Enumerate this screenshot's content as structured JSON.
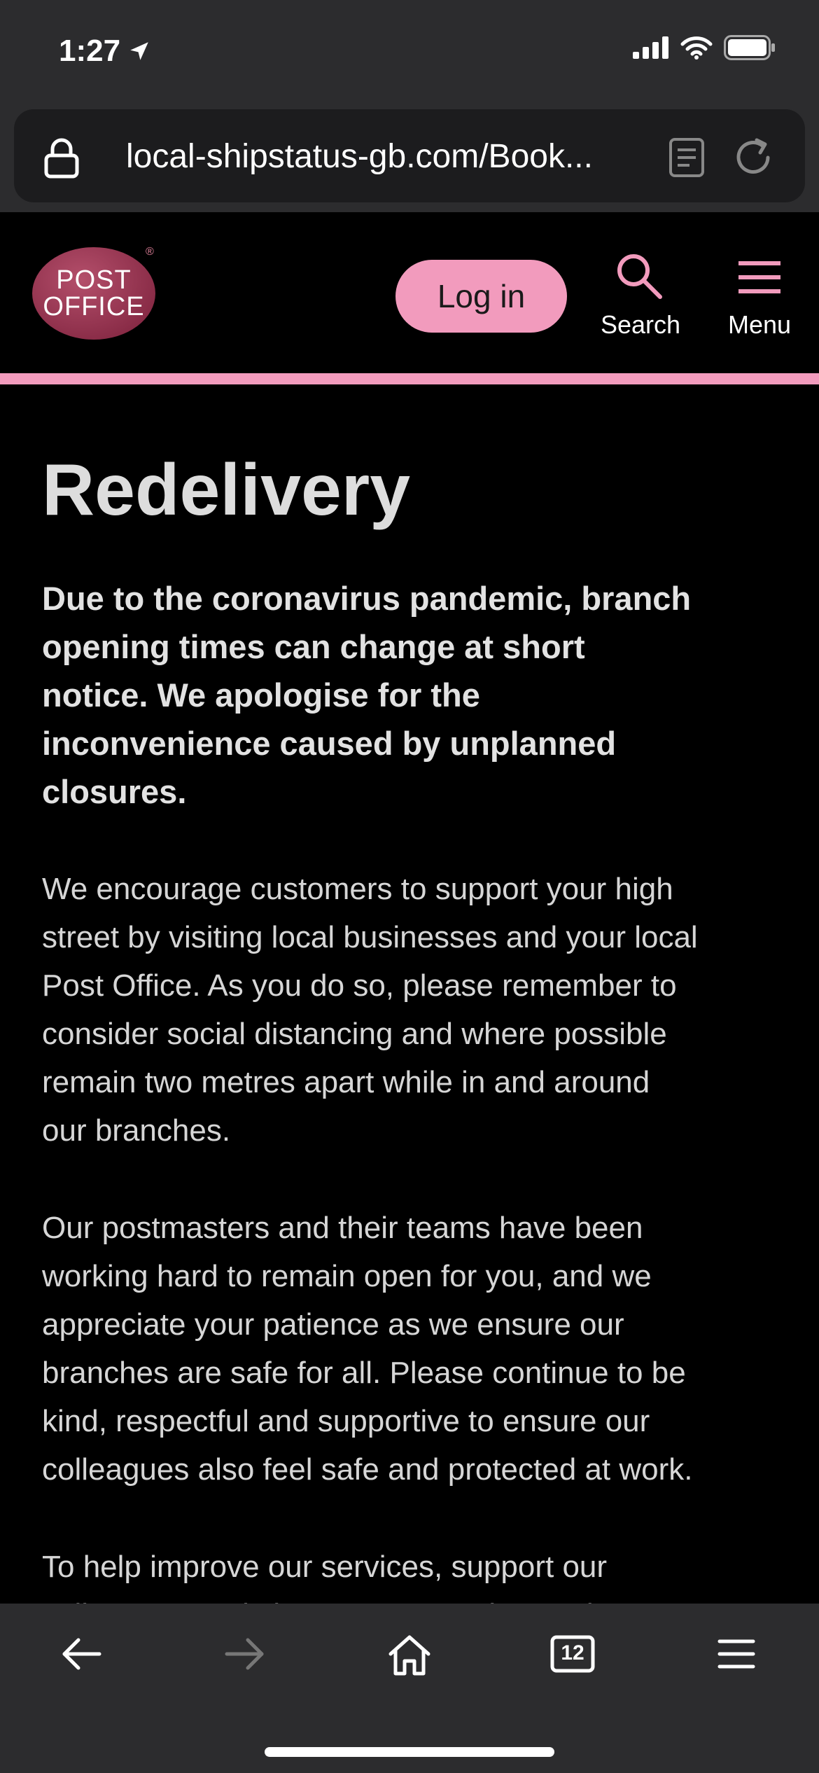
{
  "status_bar": {
    "time": "1:27"
  },
  "browser": {
    "url": "local-shipstatus-gb.com/Book...",
    "tab_count": "12"
  },
  "header": {
    "logo_line1": "POST",
    "logo_line2": "OFFICE",
    "logo_reg": "®",
    "login_label": "Log in",
    "search_label": "Search",
    "menu_label": "Menu"
  },
  "main": {
    "title": "Redelivery",
    "lead": "Due to the coronavirus pandemic, branch opening times can change at short notice. We apologise for the inconvenience caused by unplanned closures.",
    "para1": "We encourage customers to support your high street by visiting local businesses and your local Post Office. As you do so, please remember to consider social distancing and where possible remain two metres apart while in and around our branches.",
    "para2": "Our postmasters and their teams have been working hard to remain open for you, and we appreciate your patience as we ensure our branches are safe for all. Please continue to be kind, respectful and supportive to ensure our colleagues also feel safe and protected at work.",
    "para3": "To help improve our services, support our colleagues and share your experiences in"
  },
  "colors": {
    "accent_pink": "#f29bbd",
    "chrome_dark": "#2c2c2e",
    "logo_red": "#7a1f3a"
  },
  "icons": [
    "location-arrow-icon",
    "signal-icon",
    "wifi-icon",
    "battery-icon",
    "lock-icon",
    "reader-icon",
    "reload-icon",
    "search-icon",
    "hamburger-icon",
    "back-icon",
    "forward-icon",
    "home-icon",
    "tabs-icon",
    "browser-menu-icon"
  ]
}
